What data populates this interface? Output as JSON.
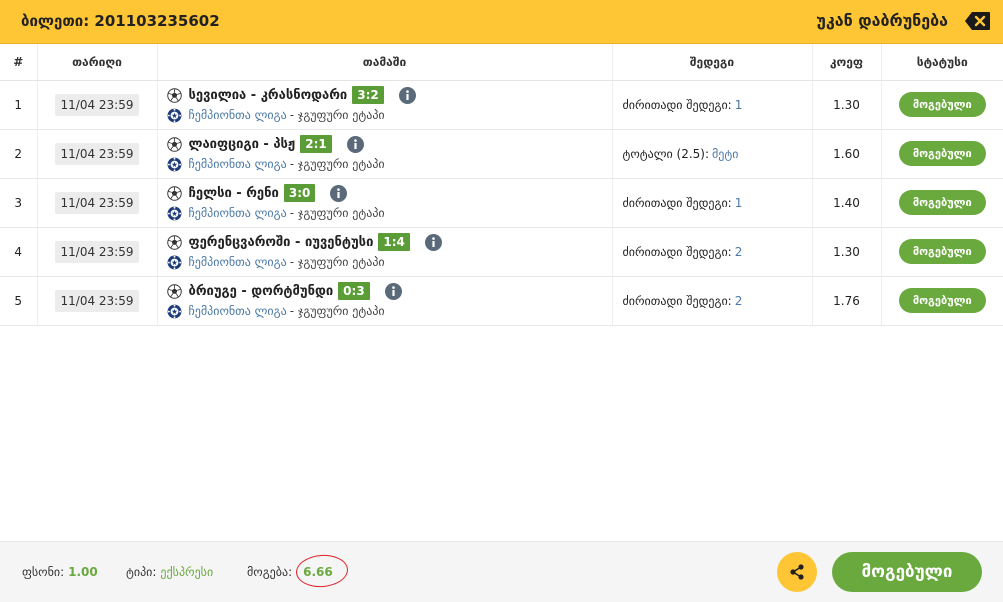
{
  "header": {
    "ticket_label": "ბილეთი: 201103235602",
    "back_label": "უკან დაბრუნება"
  },
  "columns": [
    "#",
    "თარიღი",
    "თამაში",
    "შედეგი",
    "კოეფ",
    "სტატუსი"
  ],
  "rows": [
    {
      "num": "1",
      "date": "11/04 23:59",
      "match": "სევილია - კრასნოდარი",
      "score": "3:2",
      "league": "ჩემპიონთა ლიგა",
      "stage": "- ჯგუფური ეტაპი",
      "result_label": "ძირითადი შედეგი:",
      "result_value": "1",
      "odd": "1.30",
      "status": "მოგებული"
    },
    {
      "num": "2",
      "date": "11/04 23:59",
      "match": "ლაიფციგი - პსჟ",
      "score": "2:1",
      "league": "ჩემპიონთა ლიგა",
      "stage": "- ჯგუფური ეტაპი",
      "result_label": "ტოტალი (2.5):",
      "result_value": "მეტი",
      "odd": "1.60",
      "status": "მოგებული"
    },
    {
      "num": "3",
      "date": "11/04 23:59",
      "match": "ჩელსი - რენი",
      "score": "3:0",
      "league": "ჩემპიონთა ლიგა",
      "stage": "- ჯგუფური ეტაპი",
      "result_label": "ძირითადი შედეგი:",
      "result_value": "1",
      "odd": "1.40",
      "status": "მოგებული"
    },
    {
      "num": "4",
      "date": "11/04 23:59",
      "match": "ფერენცვაროში - იუვენტუსი",
      "score": "1:4",
      "league": "ჩემპიონთა ლიგა",
      "stage": "- ჯგუფური ეტაპი",
      "result_label": "ძირითადი შედეგი:",
      "result_value": "2",
      "odd": "1.30",
      "status": "მოგებული"
    },
    {
      "num": "5",
      "date": "11/04 23:59",
      "match": "ბრიუგე - დორტმუნდი",
      "score": "0:3",
      "league": "ჩემპიონთა ლიგა",
      "stage": "- ჯგუფური ეტაპი",
      "result_label": "ძირითადი შედეგი:",
      "result_value": "2",
      "odd": "1.76",
      "status": "მოგებული"
    }
  ],
  "footer": {
    "stake_label": "ფსონი:",
    "stake_value": "1.00",
    "type_label": "ტიპი:",
    "type_value": "ექსპრესი",
    "win_label": "მოგება:",
    "win_value": "6.66",
    "status": "მოგებული"
  },
  "colors": {
    "header": "#fec535",
    "win": "#6aa93e",
    "league": "#4a78a6",
    "highlight": "#e0202a"
  },
  "icons": [
    "backspace-icon",
    "soccer-ball-icon",
    "champions-league-icon",
    "info-icon",
    "share-icon"
  ]
}
